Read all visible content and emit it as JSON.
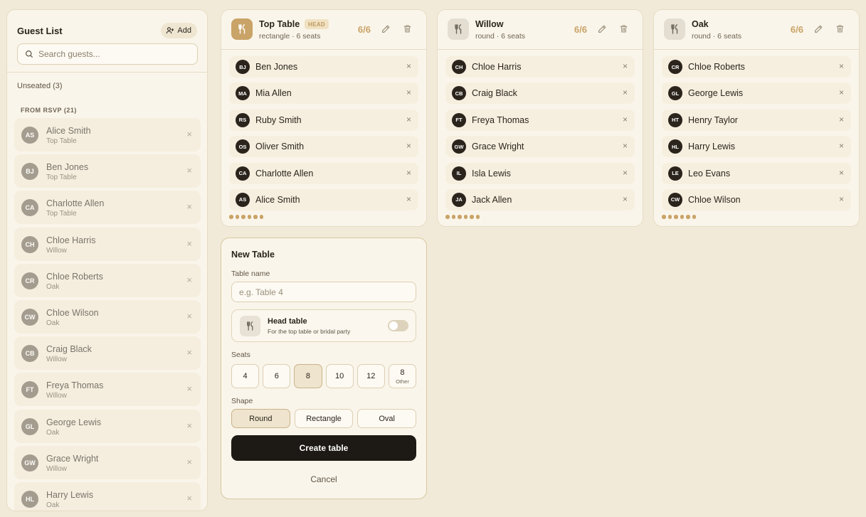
{
  "sidebar": {
    "title": "Guest List",
    "add_label": "Add",
    "search_placeholder": "Search guests...",
    "unseated_label": "Unseated (3)",
    "group_label": "FROM RSVP (21)",
    "guests": [
      {
        "initials": "AS",
        "name": "Alice Smith",
        "table": "Top Table"
      },
      {
        "initials": "BJ",
        "name": "Ben Jones",
        "table": "Top Table"
      },
      {
        "initials": "CA",
        "name": "Charlotte Allen",
        "table": "Top Table"
      },
      {
        "initials": "CH",
        "name": "Chloe Harris",
        "table": "Willow"
      },
      {
        "initials": "CR",
        "name": "Chloe Roberts",
        "table": "Oak"
      },
      {
        "initials": "CW",
        "name": "Chloe Wilson",
        "table": "Oak"
      },
      {
        "initials": "CB",
        "name": "Craig Black",
        "table": "Willow"
      },
      {
        "initials": "FT",
        "name": "Freya Thomas",
        "table": "Willow"
      },
      {
        "initials": "GL",
        "name": "George Lewis",
        "table": "Oak"
      },
      {
        "initials": "GW",
        "name": "Grace Wright",
        "table": "Willow"
      },
      {
        "initials": "HL",
        "name": "Harry Lewis",
        "table": "Oak"
      }
    ]
  },
  "tables": [
    {
      "name": "Top Table",
      "badge": "HEAD",
      "subtitle": "rectangle · 6 seats",
      "count": "6/6",
      "icon_style": "gold",
      "guests": [
        {
          "initials": "BJ",
          "name": "Ben Jones"
        },
        {
          "initials": "MA",
          "name": "Mia Allen"
        },
        {
          "initials": "RS",
          "name": "Ruby Smith"
        },
        {
          "initials": "OS",
          "name": "Oliver Smith"
        },
        {
          "initials": "CA",
          "name": "Charlotte Allen"
        },
        {
          "initials": "AS",
          "name": "Alice Smith"
        }
      ]
    },
    {
      "name": "Willow",
      "badge": "",
      "subtitle": "round · 6 seats",
      "count": "6/6",
      "icon_style": "grey",
      "guests": [
        {
          "initials": "CH",
          "name": "Chloe Harris"
        },
        {
          "initials": "CB",
          "name": "Craig Black"
        },
        {
          "initials": "FT",
          "name": "Freya Thomas"
        },
        {
          "initials": "GW",
          "name": "Grace Wright"
        },
        {
          "initials": "IL",
          "name": "Isla Lewis"
        },
        {
          "initials": "JA",
          "name": "Jack Allen"
        }
      ]
    },
    {
      "name": "Oak",
      "badge": "",
      "subtitle": "round · 6 seats",
      "count": "6/6",
      "icon_style": "grey",
      "guests": [
        {
          "initials": "CR",
          "name": "Chloe Roberts"
        },
        {
          "initials": "GL",
          "name": "George Lewis"
        },
        {
          "initials": "HT",
          "name": "Henry Taylor"
        },
        {
          "initials": "HL",
          "name": "Harry Lewis"
        },
        {
          "initials": "LE",
          "name": "Leo Evans"
        },
        {
          "initials": "CW",
          "name": "Chloe Wilson"
        }
      ]
    }
  ],
  "new_table": {
    "title": "New Table",
    "name_label": "Table name",
    "name_placeholder": "e.g. Table 4",
    "head_title": "Head table",
    "head_desc": "For the top table or bridal party",
    "seats_label": "Seats",
    "seat_options": [
      "4",
      "6",
      "8",
      "10",
      "12",
      "8"
    ],
    "seat_other_label": "Other",
    "selected_seats": "8",
    "shape_label": "Shape",
    "shape_options": [
      "Round",
      "Rectangle",
      "Oval"
    ],
    "selected_shape": "Round",
    "create_label": "Create table",
    "cancel_label": "Cancel"
  },
  "colors": {
    "background": "#f2ead8",
    "card": "#faf5ea",
    "accent_gold": "#c9a367",
    "dark": "#1d1914"
  }
}
